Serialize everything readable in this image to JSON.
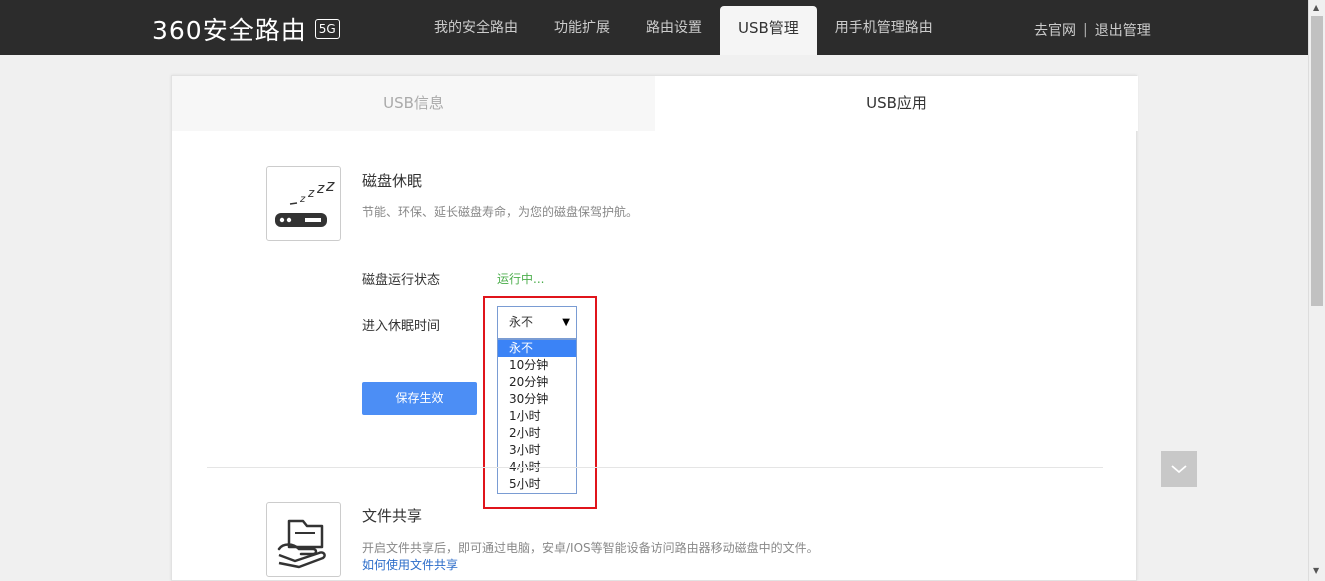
{
  "header": {
    "logo_text": "360安全路由",
    "logo_badge": "5G",
    "nav": [
      {
        "label": "我的安全路由"
      },
      {
        "label": "功能扩展"
      },
      {
        "label": "路由设置"
      },
      {
        "label": "USB管理"
      },
      {
        "label": "用手机管理路由"
      }
    ],
    "links": {
      "official": "去官网",
      "separator": "|",
      "logout": "退出管理"
    }
  },
  "tabs": {
    "usb_info": "USB信息",
    "usb_app": "USB应用"
  },
  "disk_sleep": {
    "title": "磁盘休眠",
    "desc": "节能、环保、延长磁盘寿命，为您的磁盘保驾护航。",
    "status_label": "磁盘运行状态",
    "status_value": "运行中...",
    "sleep_label": "进入休眠时间",
    "selected": "永不",
    "options": [
      "永不",
      "10分钟",
      "20分钟",
      "30分钟",
      "1小时",
      "2小时",
      "3小时",
      "4小时",
      "5小时"
    ],
    "save_label": "保存生效"
  },
  "file_share": {
    "title": "文件共享",
    "desc": "开启文件共享后，即可通过电脑，安卓/IOS等智能设备访问路由器移动磁盘中的文件。",
    "link": "如何使用文件共享"
  },
  "colors": {
    "accent": "#4c8ef5",
    "status_green": "#4cae4c",
    "highlight_red": "#e0141b",
    "link_blue": "#2b6cc9"
  }
}
